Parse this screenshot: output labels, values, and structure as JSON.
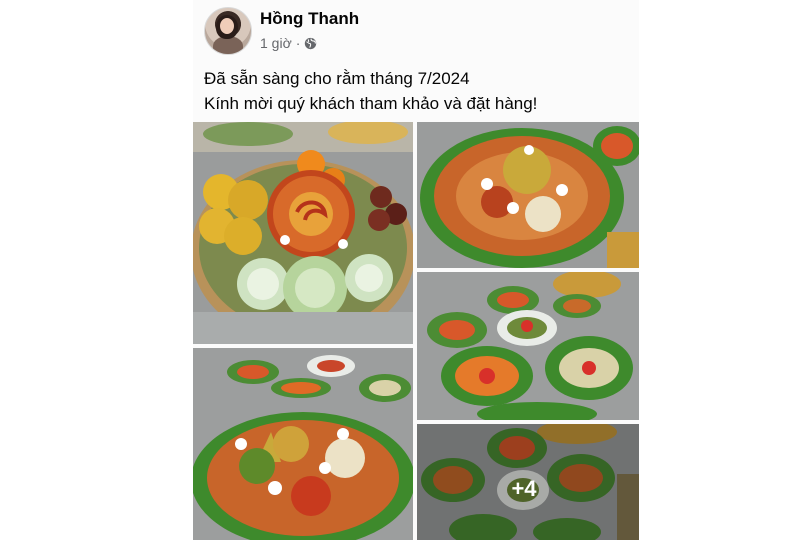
{
  "post": {
    "author_name": "Hồng Thanh",
    "timestamp": "1 giờ",
    "separator": "·",
    "audience_icon": "globe-icon",
    "caption_lines": [
      "Đã sẵn sàng cho rằm tháng 7/2024",
      "Kính mời quý khách tham khảo và đặt hàng!"
    ],
    "photos": [
      {
        "description_icon": "fruit-platter-photo"
      },
      {
        "description_icon": "vegetarian-platter-photo"
      },
      {
        "description_icon": "platter-set-photo"
      },
      {
        "description_icon": "dishes-spread-photo"
      },
      {
        "description_icon": "dishes-spread-photo-more"
      }
    ],
    "more_photos_label": "+4"
  },
  "colors": {
    "name": "#050505",
    "meta": "#65676b",
    "overlay_text": "#ffffff"
  }
}
